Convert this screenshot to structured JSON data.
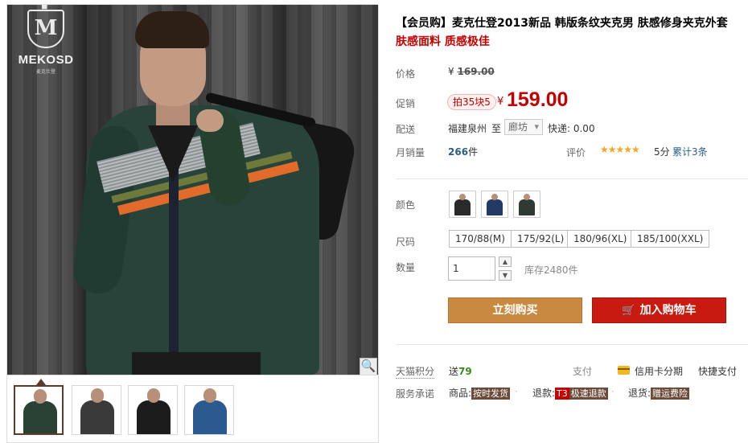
{
  "brand": {
    "name": "MEKOSD",
    "sub": "麦克仕登",
    "monogram": "M"
  },
  "product": {
    "title": "【会员购】麦克仕登2013新品 韩版条纹夹克男 肤感修身夹克外套",
    "subtitle": "肤感面料 质感极佳"
  },
  "price": {
    "label": "价格",
    "currency": "¥",
    "original": "169.00"
  },
  "promo": {
    "label": "促销",
    "tag": "拍35块5",
    "currency": "¥",
    "price": "159.00"
  },
  "shipping": {
    "label": "配送",
    "from": "福建泉州",
    "to_label": "至",
    "destination": "廊坊",
    "fee": "快递: 0.00"
  },
  "sales": {
    "label": "月销量",
    "count": "266",
    "unit": "件"
  },
  "rating": {
    "label": "评价",
    "stars": "★★★★★",
    "score": "5分",
    "total": "累计3条"
  },
  "color": {
    "label": "颜色",
    "options": [
      {
        "name": "black",
        "color": "#2a2a2a"
      },
      {
        "name": "navy",
        "color": "#243a66"
      },
      {
        "name": "dark-green",
        "color": "#2e3a33"
      }
    ]
  },
  "size": {
    "label": "尺码",
    "options": [
      "170/88(M)",
      "175/92(L)",
      "180/96(XL)",
      "185/100(XXL)"
    ]
  },
  "quantity": {
    "label": "数量",
    "value": "1",
    "up": "▲",
    "down": "▼",
    "stock": "库存2480件"
  },
  "actions": {
    "buy_now": "立刻购买",
    "add_to_cart": "加入购物车",
    "cart_icon": "🛒"
  },
  "points": {
    "label": "天猫积分",
    "prefix": "送",
    "value": "79"
  },
  "payment": {
    "label": "支付",
    "card": "信用卡分期",
    "quick": "快捷支付"
  },
  "service": {
    "label": "服务承诺",
    "items": [
      {
        "prefix": "商品:",
        "tag": "按时发货"
      },
      {
        "prefix": "退款:",
        "tag_red": "T3",
        "tag": "极速退款"
      },
      {
        "prefix": "退货:",
        "tag": "赠运费险"
      }
    ]
  },
  "gallery": {
    "zoom_icon": "🔍",
    "thumbs": [
      {
        "color": "#2a4236"
      },
      {
        "color": "#3a3a3a"
      },
      {
        "color": "#1c1c1c"
      },
      {
        "color": "#2b5a8f"
      }
    ]
  }
}
